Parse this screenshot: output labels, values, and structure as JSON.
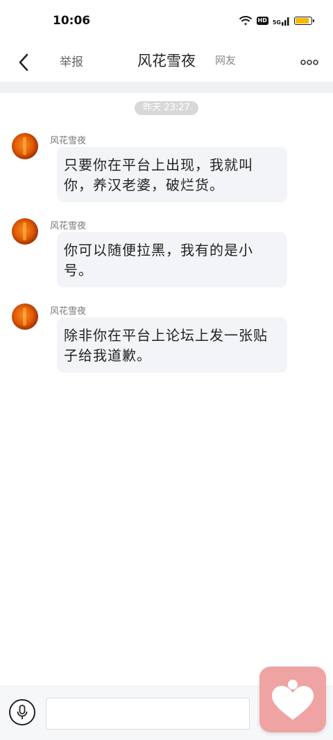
{
  "status_bar": {
    "time": "10:06",
    "hd_label": "HD",
    "network_label": "5G",
    "battery_level": 0.85,
    "battery_color": "#f5b800"
  },
  "header": {
    "report_label": "举报",
    "title": "风花雪夜",
    "tag": "网友",
    "back_icon": "chevron-left-icon",
    "more_icon": "more-dots-icon"
  },
  "conversation": {
    "timestamp": "昨天 23:27",
    "messages": [
      {
        "sender": "风花雪夜",
        "text": "只要你在平台上出现，我就叫你，养汉老婆，破烂货。"
      },
      {
        "sender": "风花雪夜",
        "text": "你可以随便拉黑，我有的是小号。"
      },
      {
        "sender": "风花雪夜",
        "text": "除非你在平台上论坛上发一张贴子给我道歉。"
      }
    ]
  },
  "input_bar": {
    "voice_icon": "microphone-icon",
    "input_value": "",
    "input_placeholder": ""
  },
  "widget": {
    "icon": "heart-person-icon",
    "color": "#f0a3a3"
  }
}
